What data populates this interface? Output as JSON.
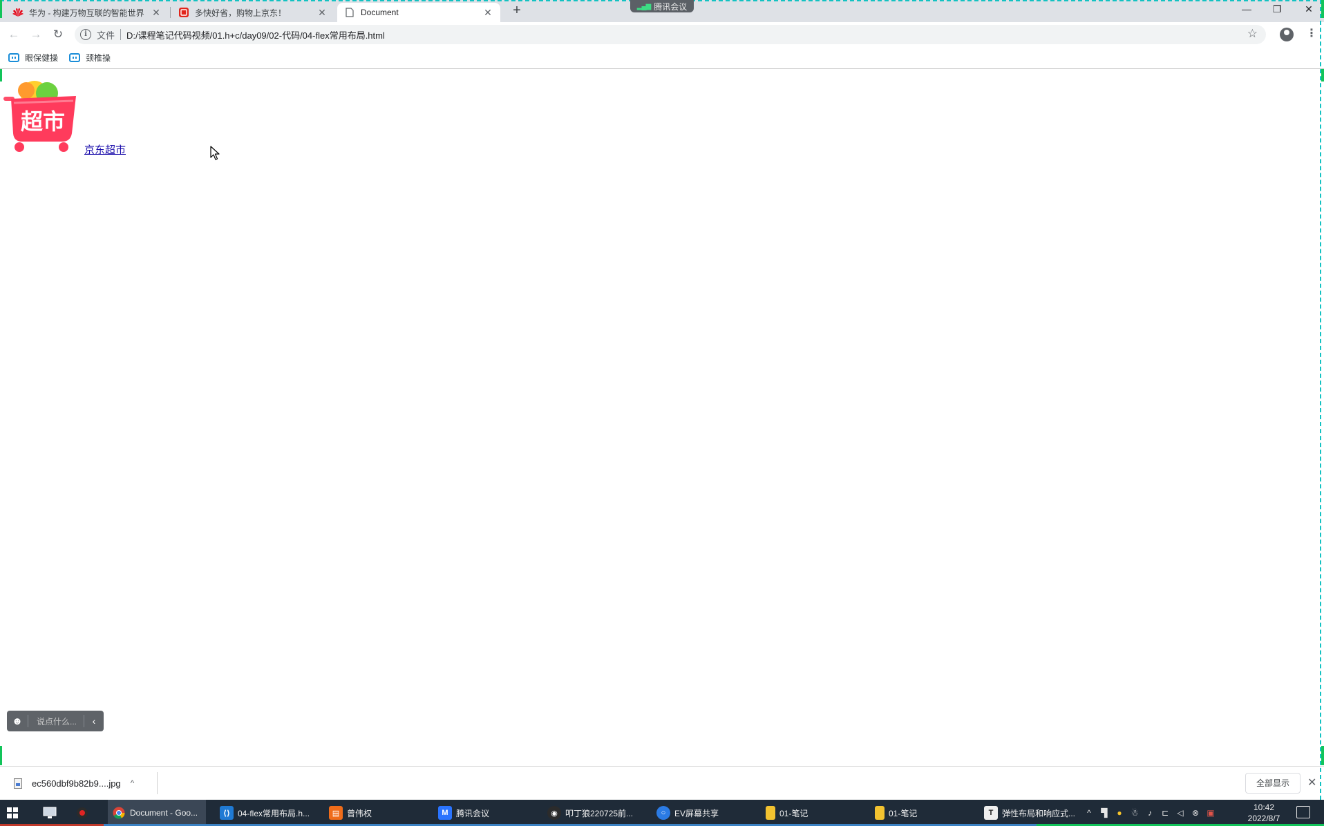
{
  "meeting": {
    "label": "腾讯会议"
  },
  "tabs": [
    {
      "title": "华为 - 构建万物互联的智能世界",
      "favicon": "huawei-icon",
      "active": false
    },
    {
      "title": "多快好省，购物上京东！",
      "favicon": "jd-icon",
      "active": false
    },
    {
      "title": "Document",
      "favicon": "document-icon",
      "active": true
    }
  ],
  "toolbar": {
    "scheme_label": "文件",
    "url": "D:/课程笔记代码视频/01.h+c/day09/02-代码/04-flex常用布局.html"
  },
  "bookmarks": [
    {
      "label": "眼保健操"
    },
    {
      "label": "颈椎操"
    }
  ],
  "page": {
    "logo_text": "超市",
    "link_text": "京东超市"
  },
  "chat": {
    "placeholder": "说点什么..."
  },
  "download": {
    "filename": "ec560dbf9b82b9....jpg",
    "show_all": "全部显示"
  },
  "taskbar": {
    "apps": [
      {
        "label": "Document - Goo...",
        "icon": "chrome-icon",
        "color": "#e9e9e9",
        "active": true
      },
      {
        "label": "04-flex常用布局.h...",
        "icon": "vscode-icon",
        "color": "#1f7ad4"
      },
      {
        "label": "曾伟权",
        "icon": "orange-app-icon",
        "color": "#ef6c1a"
      },
      {
        "label": "腾讯会议",
        "icon": "tencent-meeting-icon",
        "color": "#2a74ff"
      },
      {
        "label": "叩丁狼220725前...",
        "icon": "wolf-icon",
        "color": "#2b2b2b"
      },
      {
        "label": "EV屏幕共享",
        "icon": "ev-share-icon",
        "color": "#2b7be4"
      },
      {
        "label": "01-笔记",
        "icon": "folder-icon",
        "color": "#f2c230"
      },
      {
        "label": "01-笔记",
        "icon": "folder-icon",
        "color": "#f2c230"
      },
      {
        "label": "弹性布局和响应式...",
        "icon": "typora-icon",
        "color": "#eeeeee"
      }
    ],
    "time": "10:42",
    "date": "2022/8/7"
  }
}
